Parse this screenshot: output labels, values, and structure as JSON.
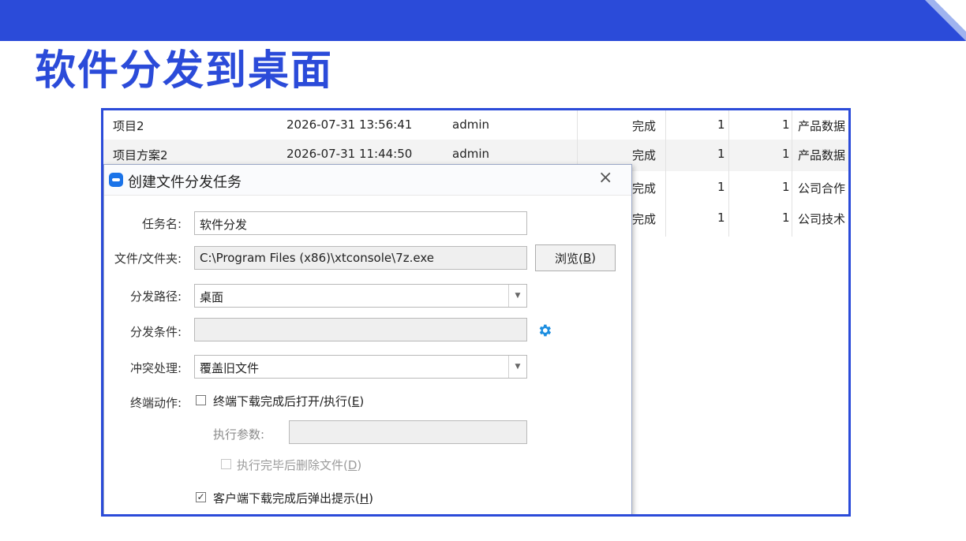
{
  "slide": {
    "title": "软件分发到桌面"
  },
  "background_table": {
    "rows": [
      {
        "name": "项目2",
        "time": "2026-07-31 13:56:41",
        "user": "admin",
        "status": "完成",
        "n1": "1",
        "n2": "1",
        "desc": "产品数据"
      },
      {
        "name": "项目方案2",
        "time": "2026-07-31 11:44:50",
        "user": "admin",
        "status": "完成",
        "n1": "1",
        "n2": "1",
        "desc": "产品数据"
      },
      {
        "name": "",
        "time": "",
        "user": "",
        "status": "完成",
        "n1": "1",
        "n2": "1",
        "desc": "公司合作"
      },
      {
        "name": "",
        "time": "",
        "user": "",
        "status": "完成",
        "n1": "1",
        "n2": "1",
        "desc": "公司技术"
      }
    ]
  },
  "dialog": {
    "title": "创建文件分发任务",
    "close": "×",
    "task_name": {
      "label": "任务名:",
      "value": "软件分发"
    },
    "file": {
      "label": "文件/文件夹:",
      "value": "C:\\Program Files (x86)\\xtconsole\\7z.exe"
    },
    "browse": {
      "label": "浏览(",
      "key": "B",
      "suffix": ")"
    },
    "path": {
      "label": "分发路径:",
      "value": "桌面"
    },
    "condition": {
      "label": "分发条件:",
      "value": ""
    },
    "conflict": {
      "label": "冲突处理:",
      "value": "覆盖旧文件"
    },
    "terminal_action": {
      "label": "终端动作:",
      "open_after_download": {
        "label": "终端下载完成后打开/执行(",
        "key": "E",
        "suffix": ")",
        "checked": false
      },
      "exec_params": {
        "label": "执行参数:",
        "value": ""
      },
      "delete_after": {
        "label": "执行完毕后删除文件(",
        "key": "D",
        "suffix": ")",
        "checked": false
      }
    },
    "popup_notice": {
      "label": "客户端下载完成后弹出提示(",
      "key": "H",
      "suffix": ")",
      "checked": true,
      "mark": "✓"
    }
  },
  "colors": {
    "brand": "#2b4bd9",
    "gear": "#1c8ee0"
  }
}
